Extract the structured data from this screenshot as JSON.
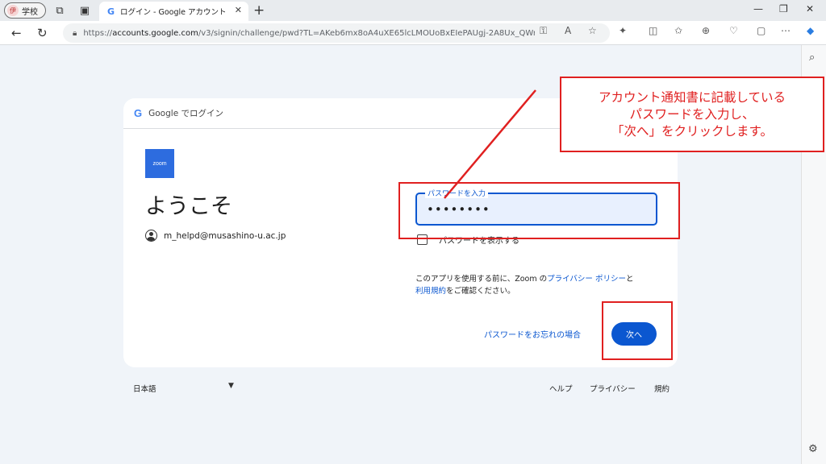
{
  "browser": {
    "profile_label": "学校",
    "profile_initial": "伊",
    "tab_title": "ログイン - Google アカウント",
    "url_prefix": "https://",
    "url_host": "accounts.google.com",
    "url_rest": "/v3/signin/challenge/pwd?TL=AKeb6mx8oA4uXE65lcLMOUoBxEIePAUgj-2A8Ux_QWrTl..."
  },
  "card": {
    "header_text": "Google でログイン",
    "zoom_logo_text": "zoom",
    "welcome": "ようこそ",
    "email": "m_helpd@musashino-u.ac.jp",
    "password_label": "パスワードを入力",
    "password_value": "••••••••",
    "show_password_label": "パスワードを表示する",
    "policy_before": "このアプリを使用する前に、Zoom の",
    "policy_link1": "プライバシー ポリシー",
    "policy_mid": "と",
    "policy_link2": "利用規約",
    "policy_after": "をご確認ください。",
    "forgot_password": "パスワードをお忘れの場合",
    "next_button": "次へ"
  },
  "footer": {
    "language": "日本語",
    "help": "ヘルプ",
    "privacy": "プライバシー",
    "terms": "規約"
  },
  "annotation": {
    "callout_text": "アカウント通知書に記載している\nパスワードを入力し、\n「次へ」をクリックします。",
    "color": "#e02020"
  }
}
